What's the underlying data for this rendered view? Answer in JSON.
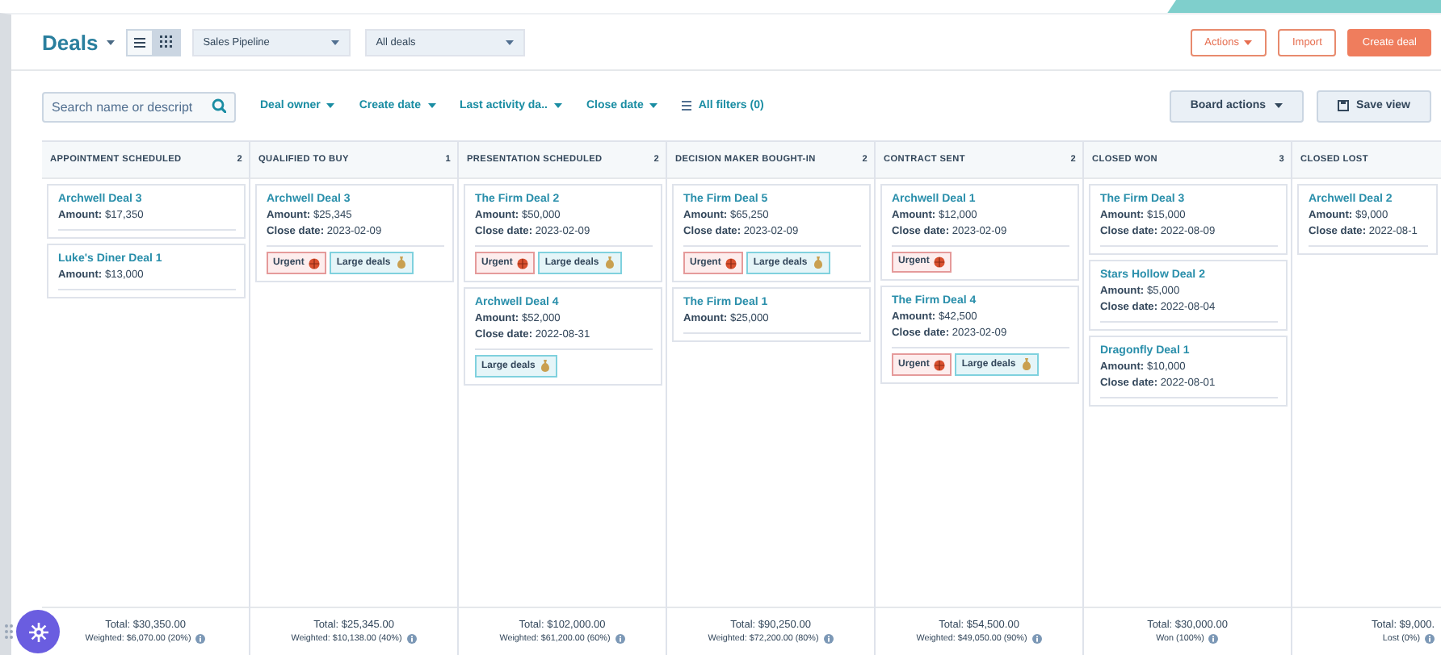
{
  "header": {
    "title": "Deals",
    "views": [
      {
        "kind": "list",
        "selected": false
      },
      {
        "kind": "board",
        "selected": true
      }
    ],
    "pipeline": "Sales Pipeline",
    "view_filter": "All deals",
    "buttons": [
      {
        "label": "Actions",
        "kind": "outline-menu"
      },
      {
        "label": "Import",
        "kind": "outline"
      },
      {
        "label": "Create deal",
        "kind": "primary"
      }
    ]
  },
  "filters": {
    "search": {
      "placeholder": "Search name or descript"
    },
    "items": [
      {
        "label": "Deal owner",
        "kind": "menu"
      },
      {
        "label": "Create date",
        "kind": "menu"
      },
      {
        "label": "Last activity da..",
        "kind": "menu"
      },
      {
        "label": "Close date",
        "kind": "menu"
      },
      {
        "label": "All filters (0)",
        "kind": "filters"
      }
    ],
    "board_actions": "Board actions",
    "save_view": "Save view"
  },
  "columns": [
    {
      "title": "APPOINTMENT SCHEDULED",
      "count": "2",
      "cards": [
        {
          "title": "Archwell Deal 3",
          "amount": "**Amount:** $17,350"
        },
        {
          "title": "Luke's Diner Deal 1",
          "amount": "**Amount:** $13,000"
        }
      ],
      "total": "Total: $30,350.00",
      "note": "Weighted: $6,070.00 (20%)"
    },
    {
      "title": "QUALIFIED TO BUY",
      "count": "1",
      "cards": [
        {
          "title": "Archwell Deal 3",
          "amount": "**Amount:** $25,345",
          "close_date": "**Close date:** 2023-02-09",
          "tags": [
            {
              "label": "Urgent",
              "kind": "urgent"
            },
            {
              "label": "Large deals",
              "kind": "large"
            }
          ]
        }
      ],
      "total": "Total: $25,345.00",
      "note": "Weighted: $10,138.00 (40%)"
    },
    {
      "title": "PRESENTATION SCHEDULED",
      "count": "2",
      "cards": [
        {
          "title": "The Firm Deal 2",
          "amount": "**Amount:** $50,000",
          "close_date": "**Close date:** 2023-02-09",
          "tags": [
            {
              "label": "Urgent",
              "kind": "urgent"
            },
            {
              "label": "Large deals",
              "kind": "large"
            }
          ]
        },
        {
          "title": "Archwell Deal 4",
          "amount": "**Amount:** $52,000",
          "close_date": "**Close date:** 2022-08-31",
          "tags": [
            {
              "label": "Large deals",
              "kind": "large"
            }
          ]
        }
      ],
      "total": "Total: $102,000.00",
      "note": "Weighted: $61,200.00 (60%)"
    },
    {
      "title": "DECISION MAKER BOUGHT-IN",
      "count": "2",
      "cards": [
        {
          "title": "The Firm Deal 5",
          "amount": "**Amount:** $65,250",
          "close_date": "**Close date:** 2023-02-09",
          "tags": [
            {
              "label": "Urgent",
              "kind": "urgent"
            },
            {
              "label": "Large deals",
              "kind": "large"
            }
          ]
        },
        {
          "title": "The Firm Deal 1",
          "amount": "**Amount:** $25,000"
        }
      ],
      "total": "Total: $90,250.00",
      "note": "Weighted: $72,200.00 (80%)"
    },
    {
      "title": "CONTRACT SENT",
      "count": "2",
      "cards": [
        {
          "title": "Archwell Deal 1",
          "amount": "**Amount:** $12,000",
          "close_date": "**Close date:** 2023-02-09",
          "tags": [
            {
              "label": "Urgent",
              "kind": "urgent"
            }
          ]
        },
        {
          "title": "The Firm Deal 4",
          "amount": "**Amount:** $42,500",
          "close_date": "**Close date:** 2023-02-09",
          "tags": [
            {
              "label": "Urgent",
              "kind": "urgent"
            },
            {
              "label": "Large deals",
              "kind": "large"
            }
          ]
        }
      ],
      "total": "Total: $54,500.00",
      "note": "Weighted: $49,050.00 (90%)"
    },
    {
      "title": "CLOSED WON",
      "count": "3",
      "cards": [
        {
          "title": "The Firm Deal 3",
          "amount": "**Amount:** $15,000",
          "close_date": "**Close date:** 2022-08-09"
        },
        {
          "title": "Stars Hollow Deal 2",
          "amount": "**Amount:** $5,000",
          "close_date": "**Close date:** 2022-08-04"
        },
        {
          "title": "Dragonfly Deal 1",
          "amount": "**Amount:** $10,000",
          "close_date": "**Close date:** 2022-08-01"
        }
      ],
      "total": "Total: $30,000.00",
      "note": "Won (100%)"
    },
    {
      "title": "CLOSED LOST",
      "cards": [
        {
          "title": "Archwell Deal 2",
          "amount": "**Amount:** $9,000",
          "close_date": "**Close date:** 2022-08-1"
        }
      ],
      "total": "Total: $9,000.",
      "note": "Lost (0%)"
    }
  ]
}
